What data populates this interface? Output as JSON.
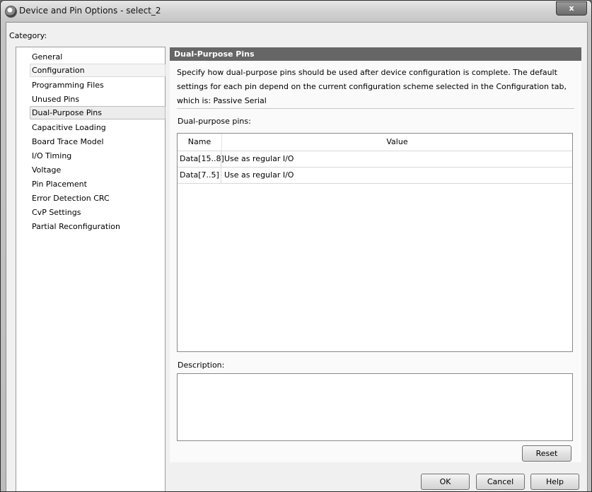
{
  "window": {
    "title": "Device and Pin Options - select_2",
    "close_glyph": "x"
  },
  "category": {
    "label": "Category:",
    "items": [
      {
        "label": "General"
      },
      {
        "label": "Configuration"
      },
      {
        "label": "Programming Files"
      },
      {
        "label": "Unused Pins"
      },
      {
        "label": "Dual-Purpose Pins"
      },
      {
        "label": "Capacitive Loading"
      },
      {
        "label": "Board Trace Model"
      },
      {
        "label": "I/O Timing"
      },
      {
        "label": "Voltage"
      },
      {
        "label": "Pin Placement"
      },
      {
        "label": "Error Detection CRC"
      },
      {
        "label": "CvP Settings"
      },
      {
        "label": "Partial Reconfiguration"
      }
    ],
    "selected": "Dual-Purpose Pins"
  },
  "panel": {
    "header": "Dual-Purpose Pins",
    "description": "Specify how dual-purpose pins should be used after device configuration is complete. The default settings for each pin depend on the current configuration scheme selected in the Configuration tab, which is:  Passive Serial",
    "pins_label": "Dual-purpose pins:",
    "table": {
      "columns": [
        "Name",
        "Value"
      ],
      "rows": [
        {
          "name": "Data[15..8]",
          "value": "Use as regular I/O"
        },
        {
          "name": "Data[7..5]",
          "value": "Use as regular I/O"
        }
      ]
    },
    "description_label": "Description:",
    "description_value": "",
    "reset_label": "Reset"
  },
  "footer": {
    "ok_label": "OK",
    "cancel_label": "Cancel",
    "help_label": "Help"
  }
}
